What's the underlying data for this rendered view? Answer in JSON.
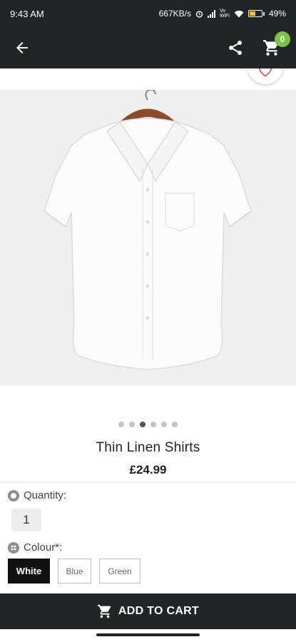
{
  "status_bar": {
    "time": "9:43 AM",
    "net_speed": "667KB/s",
    "volte": "Vo WiFi",
    "battery": "49%"
  },
  "app_bar": {
    "back_icon": "arrow-left-icon",
    "share_icon": "share-icon",
    "cart_icon": "cart-icon",
    "cart_count": "0",
    "badge_color": "#7cc243",
    "bar_color": "#222427"
  },
  "product": {
    "image_subject": "white short-sleeve linen shirt on wooden hanger",
    "title": "Thin Linen Shirts",
    "price": "£24.99",
    "image_count": 6,
    "active_image_index": 2
  },
  "options": {
    "quantity_label": "Quantity:",
    "quantity_value": "1",
    "colour_label": "Colour*:",
    "colours": [
      {
        "label": "White",
        "selected": true
      },
      {
        "label": "Blue",
        "selected": false
      },
      {
        "label": "Green",
        "selected": false
      }
    ]
  },
  "actions": {
    "add_to_cart": "ADD TO CART"
  }
}
